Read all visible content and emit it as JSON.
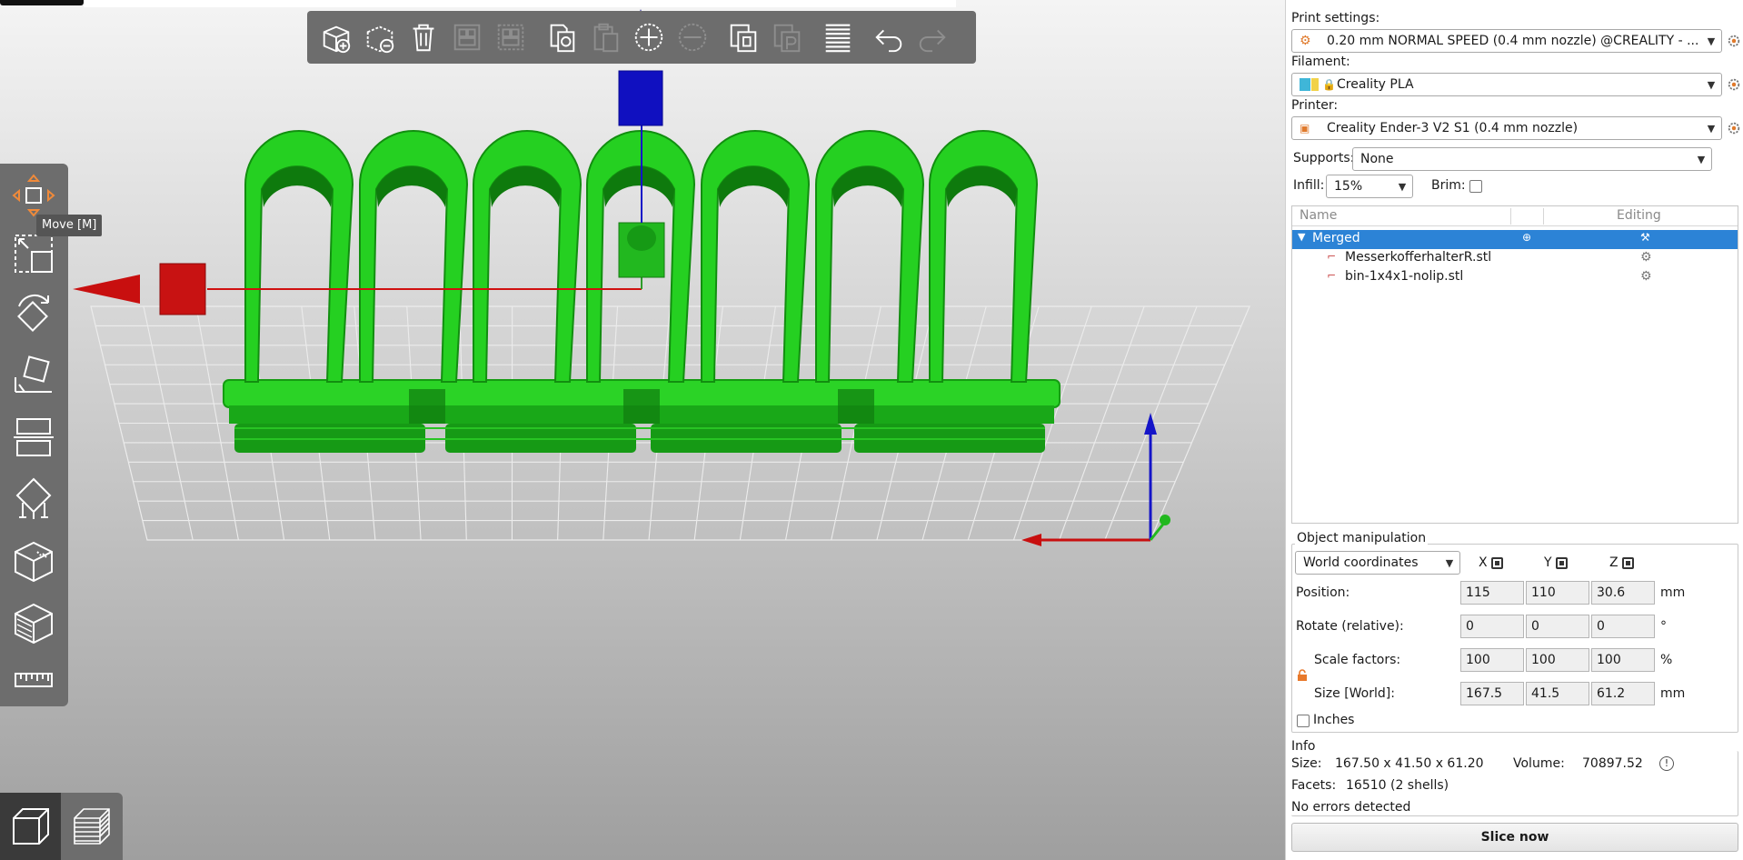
{
  "viewport": {
    "tooltip": "Move [M]",
    "top_toolbar_icons": [
      "add-icon",
      "delete-icon",
      "delete-all-icon",
      "arrange-icon",
      "arrange-selection-icon",
      "copy-icon",
      "paste-icon",
      "add-instance-icon",
      "remove-instance-icon",
      "split-to-objects-icon",
      "split-to-parts-icon",
      "layers-editing-icon",
      "undo-icon",
      "redo-icon"
    ],
    "left_toolbar_icons": [
      "move-icon",
      "scale-icon",
      "rotate-icon",
      "place-on-face-icon",
      "cut-icon",
      "supports-icon",
      "seam-icon",
      "mmu-segmentation-icon",
      "measure-icon"
    ],
    "view_toggle_icons": [
      "3d-view-icon",
      "preview-icon"
    ],
    "model_color": "#22c21f",
    "grid_color": "#e6e6e6"
  },
  "panel": {
    "print_settings": {
      "label": "Print settings:",
      "value": "0.20 mm NORMAL SPEED (0.4 mm nozzle) @CREALITY - ..."
    },
    "filament": {
      "label": "Filament:",
      "value": "Creality PLA",
      "swatch_color": "#3fb6d8"
    },
    "printer": {
      "label": "Printer:",
      "value": "Creality Ender-3 V2 S1 (0.4 mm nozzle)"
    },
    "supports": {
      "label": "Supports:",
      "value": "None"
    },
    "infill": {
      "label": "Infill:",
      "value": "15%"
    },
    "brim": {
      "label": "Brim:",
      "checked": false
    },
    "object_list": {
      "col_name": "Name",
      "col_editing": "Editing",
      "rows": [
        {
          "name": "Merged",
          "selected": true
        },
        {
          "name": "MesserkofferhalterR.stl",
          "selected": false
        },
        {
          "name": "bin-1x4x1-nolip.stl",
          "selected": false
        }
      ]
    },
    "manipulation": {
      "title": "Object manipulation",
      "coord_system": "World coordinates",
      "axis_x": "X",
      "axis_y": "Y",
      "axis_z": "Z",
      "position": {
        "label": "Position:",
        "x": "115",
        "y": "110",
        "z": "30.6",
        "unit": "mm"
      },
      "rotate": {
        "label": "Rotate (relative):",
        "x": "0",
        "y": "0",
        "z": "0",
        "unit": "°"
      },
      "scale": {
        "label": "Scale factors:",
        "x": "100",
        "y": "100",
        "z": "100",
        "unit": "%"
      },
      "size": {
        "label": "Size [World]:",
        "x": "167.5",
        "y": "41.5",
        "z": "61.2",
        "unit": "mm"
      },
      "inches_label": "Inches"
    },
    "info": {
      "title": "Info",
      "size_label": "Size:",
      "size_value": "167.50 x 41.50 x 61.20",
      "volume_label": "Volume:",
      "volume_value": "70897.52",
      "facets_label": "Facets:",
      "facets_value": "16510 (2 shells)",
      "errors": "No errors detected"
    },
    "slice_button": "Slice now"
  }
}
